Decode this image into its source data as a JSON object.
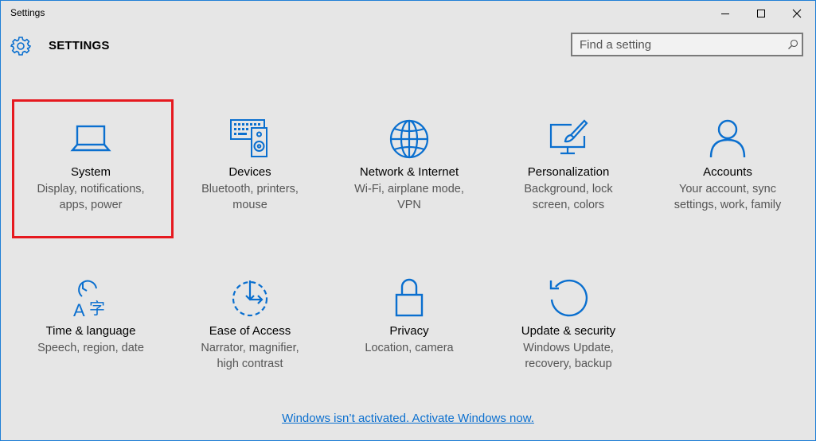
{
  "window": {
    "title": "Settings"
  },
  "header": {
    "title": "SETTINGS",
    "search_placeholder": "Find a setting"
  },
  "colors": {
    "accent": "#0a6fcf",
    "highlight": "#e6191f"
  },
  "categories": [
    {
      "name": "System",
      "description": "Display, notifications, apps, power",
      "desc_lines": [
        "Display, notifications,",
        "apps, power"
      ],
      "icon": "laptop-icon",
      "selected": true
    },
    {
      "name": "Devices",
      "description": "Bluetooth, printers, mouse",
      "desc_lines": [
        "Bluetooth, printers,",
        "mouse"
      ],
      "icon": "keyboard-speaker-icon"
    },
    {
      "name": "Network & Internet",
      "description": "Wi-Fi, airplane mode, VPN",
      "desc_lines": [
        "Wi-Fi, airplane mode,",
        "VPN"
      ],
      "icon": "globe-icon"
    },
    {
      "name": "Personalization",
      "description": "Background, lock screen, colors",
      "desc_lines": [
        "Background, lock",
        "screen, colors"
      ],
      "icon": "monitor-brush-icon"
    },
    {
      "name": "Accounts",
      "description": "Your account, sync settings, work, family",
      "desc_lines": [
        "Your account, sync",
        "settings, work, family"
      ],
      "icon": "person-icon"
    },
    {
      "name": "Time & language",
      "description": "Speech, region, date",
      "desc_lines": [
        "Speech, region, date"
      ],
      "icon": "clock-language-icon"
    },
    {
      "name": "Ease of Access",
      "description": "Narrator, magnifier, high contrast",
      "desc_lines": [
        "Narrator, magnifier,",
        "high contrast"
      ],
      "icon": "ease-of-access-icon"
    },
    {
      "name": "Privacy",
      "description": "Location, camera",
      "desc_lines": [
        "Location, camera"
      ],
      "icon": "lock-icon"
    },
    {
      "name": "Update & security",
      "description": "Windows Update, recovery, backup",
      "desc_lines": [
        "Windows Update,",
        "recovery, backup"
      ],
      "icon": "refresh-icon"
    }
  ],
  "footer": {
    "activation_link": "Windows isn’t activated. Activate Windows now."
  }
}
